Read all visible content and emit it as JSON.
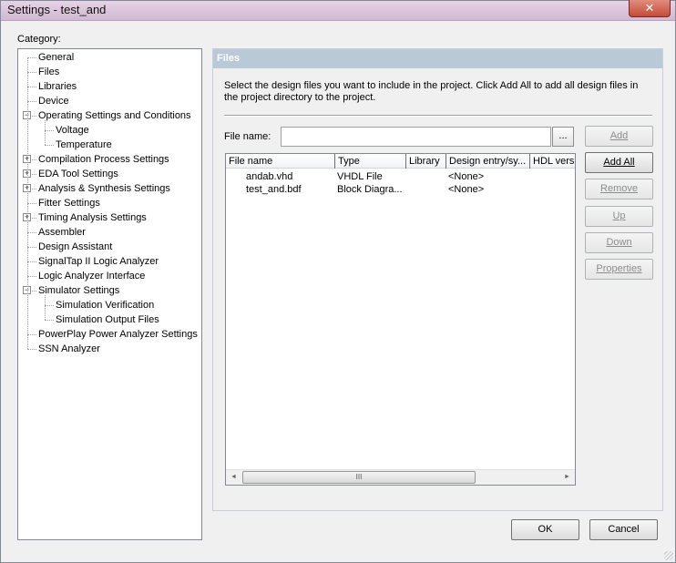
{
  "window": {
    "title": "Settings - test_and",
    "close_glyph": "✕"
  },
  "category_label": "Category:",
  "tree": [
    {
      "label": "General",
      "level": 0,
      "expander": ""
    },
    {
      "label": "Files",
      "level": 0,
      "expander": ""
    },
    {
      "label": "Libraries",
      "level": 0,
      "expander": ""
    },
    {
      "label": "Device",
      "level": 0,
      "expander": ""
    },
    {
      "label": "Operating Settings and Conditions",
      "level": 0,
      "expander": "−"
    },
    {
      "label": "Voltage",
      "level": 1,
      "expander": ""
    },
    {
      "label": "Temperature",
      "level": 1,
      "expander": ""
    },
    {
      "label": "Compilation Process Settings",
      "level": 0,
      "expander": "+"
    },
    {
      "label": "EDA Tool Settings",
      "level": 0,
      "expander": "+"
    },
    {
      "label": "Analysis & Synthesis Settings",
      "level": 0,
      "expander": "+"
    },
    {
      "label": "Fitter Settings",
      "level": 0,
      "expander": ""
    },
    {
      "label": "Timing Analysis Settings",
      "level": 0,
      "expander": "+"
    },
    {
      "label": "Assembler",
      "level": 0,
      "expander": ""
    },
    {
      "label": "Design Assistant",
      "level": 0,
      "expander": ""
    },
    {
      "label": "SignalTap II Logic Analyzer",
      "level": 0,
      "expander": ""
    },
    {
      "label": "Logic Analyzer Interface",
      "level": 0,
      "expander": ""
    },
    {
      "label": "Simulator Settings",
      "level": 0,
      "expander": "−"
    },
    {
      "label": "Simulation Verification",
      "level": 1,
      "expander": ""
    },
    {
      "label": "Simulation Output Files",
      "level": 1,
      "expander": ""
    },
    {
      "label": "PowerPlay Power Analyzer Settings",
      "level": 0,
      "expander": ""
    },
    {
      "label": "SSN Analyzer",
      "level": 0,
      "expander": ""
    }
  ],
  "panel": {
    "title": "Files",
    "description": "Select the design files you want to include in the project. Click Add All to add all design files in the project directory to the project.",
    "file_name_label": "File name:",
    "file_name_value": "",
    "browse_label": "...",
    "columns": [
      "File name",
      "Type",
      "Library",
      "Design entry/sy...",
      "HDL vers"
    ],
    "rows": [
      [
        "andab.vhd",
        "VHDL File",
        "",
        "<None>",
        ""
      ],
      [
        "test_and.bdf",
        "Block Diagra...",
        "",
        "<None>",
        ""
      ]
    ],
    "scroll_left": "◄",
    "scroll_right": "►",
    "scroll_thumb": "III",
    "buttons": {
      "add": "Add",
      "add_all": "Add All",
      "remove": "Remove",
      "up": "Up",
      "down": "Down",
      "properties": "Properties"
    }
  },
  "footer": {
    "ok": "OK",
    "cancel": "Cancel"
  }
}
